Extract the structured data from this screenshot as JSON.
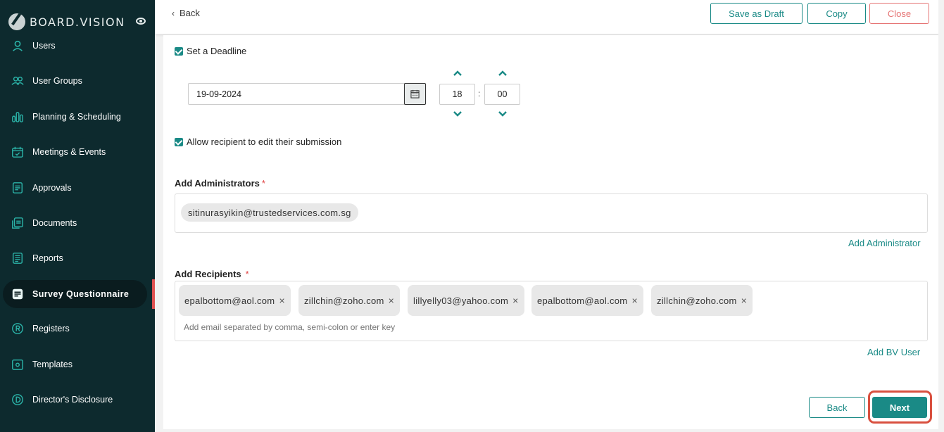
{
  "app": {
    "logo_text": "BOARD.VISION"
  },
  "sidebar": {
    "items": [
      {
        "label": "Users",
        "icon": "user-icon"
      },
      {
        "label": "User Groups",
        "icon": "users-icon"
      },
      {
        "label": "Planning & Scheduling",
        "icon": "bar-chart-icon"
      },
      {
        "label": "Meetings & Events",
        "icon": "calendar-icon"
      },
      {
        "label": "Approvals",
        "icon": "approval-doc-icon"
      },
      {
        "label": "Documents",
        "icon": "documents-icon"
      },
      {
        "label": "Reports",
        "icon": "report-icon"
      },
      {
        "label": "Survey Questionnaire",
        "icon": "survey-icon",
        "active": true
      },
      {
        "label": "Registers",
        "icon": "registered-icon"
      },
      {
        "label": "Templates",
        "icon": "template-icon"
      },
      {
        "label": "Director's Disclosure",
        "icon": "disclosure-icon"
      }
    ]
  },
  "header": {
    "back_label": "Back",
    "save_draft_label": "Save as Draft",
    "copy_label": "Copy",
    "close_label": "Close"
  },
  "form": {
    "deadline_label": "Set a Deadline",
    "deadline_checked": true,
    "date_value": "19-09-2024",
    "hour_value": "18",
    "minute_value": "00",
    "time_separator": ":",
    "allow_edit_label": "Allow recipient to edit their submission",
    "allow_edit_checked": true,
    "admins_label": "Add Administrators",
    "required_mark": "*",
    "admins": [
      "sitinurasyikin@trustedservices.com.sg"
    ],
    "add_admin_link": "Add Administrator",
    "recipients_label": "Add Recipients",
    "recipients": [
      "epalbottom@aol.com",
      "zillchin@zoho.com",
      "lillyelly03@yahoo.com",
      "epalbottom@aol.com",
      "zillchin@zoho.com"
    ],
    "remove_glyph": "×",
    "recipients_placeholder": "Add email separated by comma, semi-colon or enter key",
    "add_bv_user_link": "Add BV User"
  },
  "footer": {
    "back_label": "Back",
    "next_label": "Next"
  },
  "colors": {
    "sidebar_bg": "#0d2a2e",
    "accent": "#1a8a86",
    "danger": "#e57373",
    "highlight_ring": "#d9503f"
  }
}
